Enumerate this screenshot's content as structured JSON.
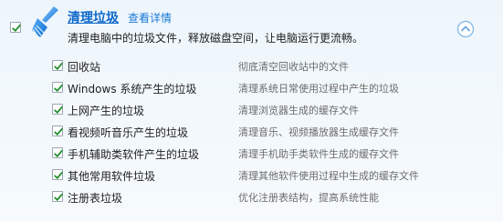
{
  "header": {
    "title": "清理垃圾",
    "details_link": "查看详情",
    "description": "清理电脑中的垃圾文件，释放磁盘空间，让电脑运行更流畅。",
    "checked": true,
    "icon": "broom-icon",
    "collapse_icon": "chevron-up-circle-icon"
  },
  "items": [
    {
      "label": "回收站",
      "description": "彻底清空回收站中的文件",
      "checked": true
    },
    {
      "label": "Windows 系统产生的垃圾",
      "description": "清理系统日常使用过程中产生的垃圾",
      "checked": true
    },
    {
      "label": "上网产生的垃圾",
      "description": "清理浏览器生成的缓存文件",
      "checked": true
    },
    {
      "label": "看视频听音乐产生的垃圾",
      "description": "清理音乐、视频播放器生成缓存文件",
      "checked": true
    },
    {
      "label": "手机辅助类软件产生的垃圾",
      "description": "清理手机助手类软件生成的缓存文件",
      "checked": true
    },
    {
      "label": "其他常用软件垃圾",
      "description": "清理其他软件使用过程中生成的缓存文件",
      "checked": true
    },
    {
      "label": "注册表垃圾",
      "description": "优化注册表结构，提高系统性能",
      "checked": true
    }
  ],
  "colors": {
    "accent": "#0d68c9",
    "check": "#1f8f2b",
    "background_top": "#eef6fc",
    "background_bottom": "#f6fafd"
  }
}
